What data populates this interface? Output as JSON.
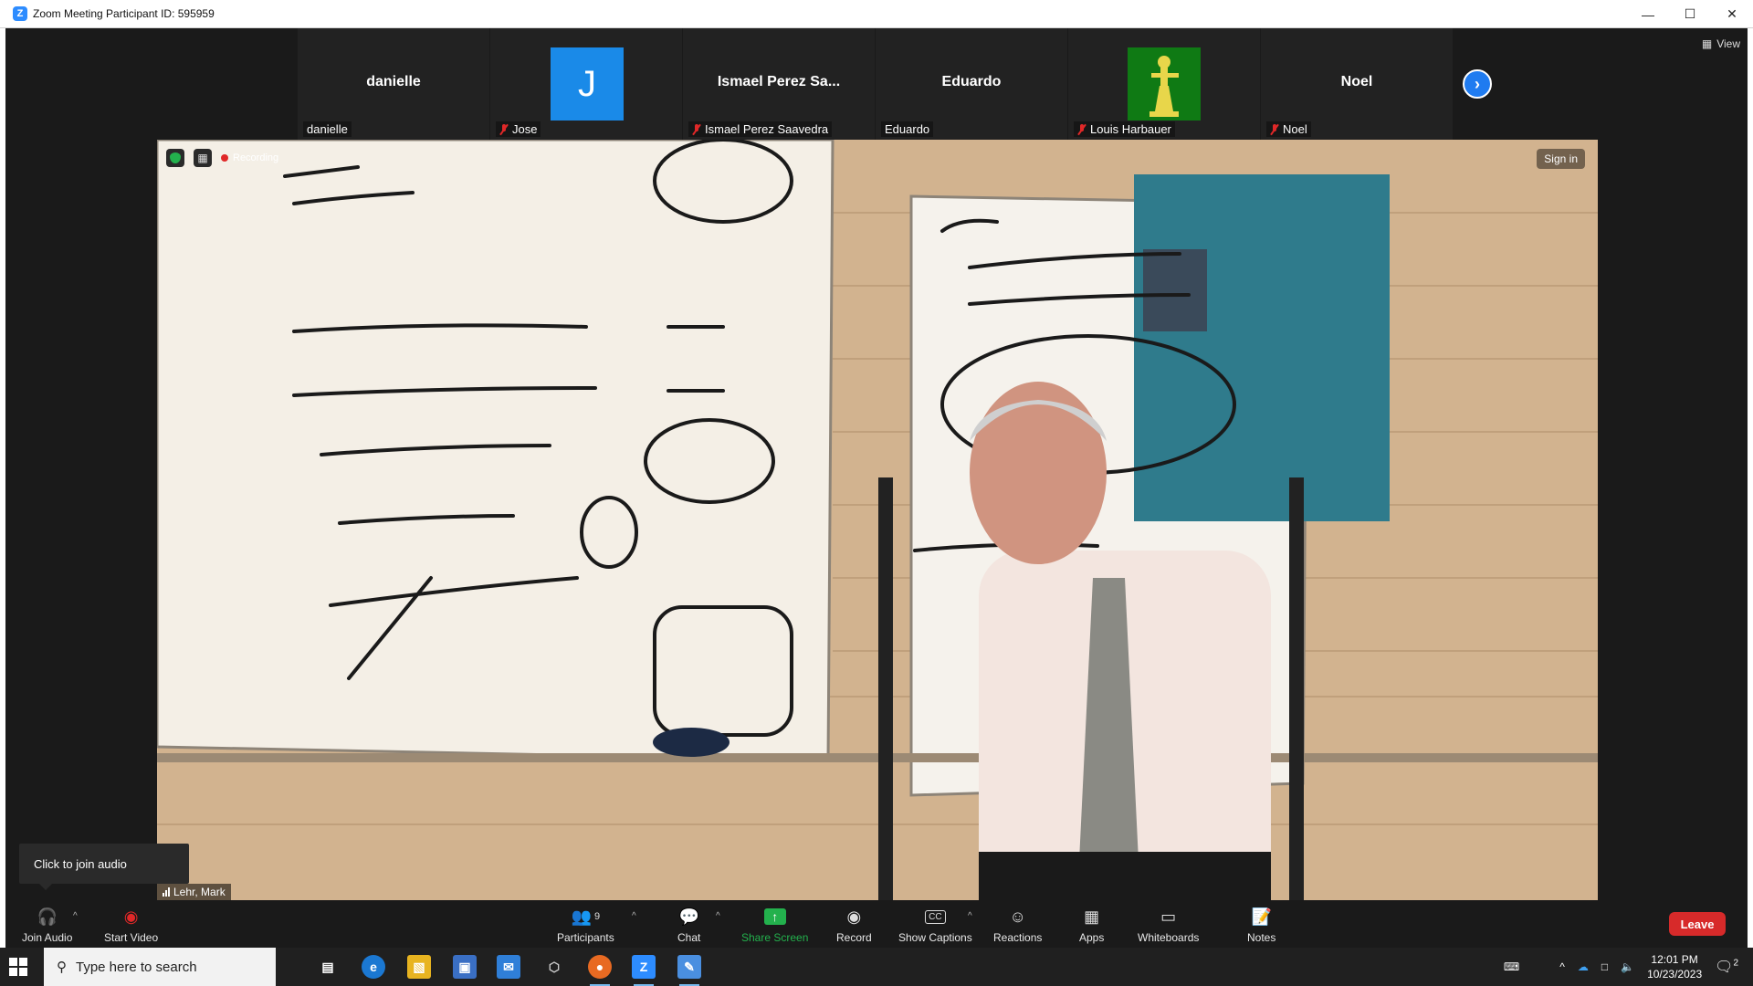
{
  "window": {
    "title": "Zoom Meeting Participant ID: 595959"
  },
  "participants_strip": {
    "tiles": [
      {
        "big_name": "danielle",
        "label": "danielle",
        "muted": false
      },
      {
        "avatar_letter": "J",
        "label": "Jose",
        "muted": true
      },
      {
        "big_name": "Ismael Perez Sa...",
        "label": "Ismael Perez Saavedra",
        "muted": true
      },
      {
        "big_name": "Eduardo",
        "label": "Eduardo",
        "muted": false
      },
      {
        "label": "Louis Harbauer",
        "muted": true
      },
      {
        "big_name": "Noel",
        "label": "Noel",
        "muted": true
      }
    ],
    "view_label": "View"
  },
  "video": {
    "recording_label": "Recording",
    "sign_in_label": "Sign in",
    "speaker_name": "Lehr, Mark"
  },
  "tooltip": {
    "text": "Click to join audio"
  },
  "toolbar": {
    "join_audio": "Join Audio",
    "start_video": "Start Video",
    "participants": "Participants",
    "participants_count": "9",
    "chat": "Chat",
    "share_screen": "Share Screen",
    "record": "Record",
    "show_captions": "Show Captions",
    "reactions": "Reactions",
    "apps": "Apps",
    "whiteboards": "Whiteboards",
    "notes": "Notes",
    "leave": "Leave"
  },
  "taskbar": {
    "search_placeholder": "Type here to search",
    "time": "12:01 PM",
    "date": "10/23/2023",
    "notification_count": "2"
  },
  "colors": {
    "accent": "#2d8cff",
    "leave": "#d72a2a",
    "share": "#23b14d"
  }
}
